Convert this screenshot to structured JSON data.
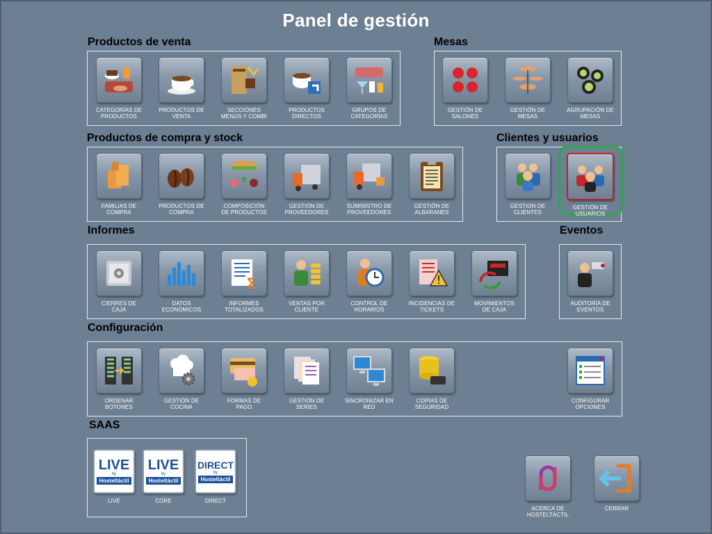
{
  "page_title": "Panel de gestión",
  "sections": {
    "productos_venta": "Productos de venta",
    "mesas": "Mesas",
    "compra_stock": "Productos de compra y stock",
    "clientes": "Clientes y usuarios",
    "informes": "Informes",
    "eventos": "Eventos",
    "configuracion": "Configuración",
    "saas": "SAAS"
  },
  "buttons": {
    "categorias_productos": [
      "CATEGORÍAS DE",
      "PRODUCTOS"
    ],
    "productos_venta": [
      "PRODUCTOS DE",
      "VENTA"
    ],
    "secciones_menus": [
      "SECCIONES",
      "MENÚS Y COMBI"
    ],
    "productos_directos": [
      "PRODUCTOS",
      "DIRECTOS"
    ],
    "grupos_categorias": [
      "GRUPOS DE",
      "CATEGORÍAS"
    ],
    "gestion_salones": [
      "GESTIÓN DE",
      "SALONES"
    ],
    "gestion_mesas": [
      "GESTIÓN DE",
      "MESAS"
    ],
    "agrupacion_mesas": [
      "AGRUPACIÓN DE",
      "MESAS"
    ],
    "familias_compra": [
      "FAMILIAS DE",
      "COMPRA"
    ],
    "productos_compra": [
      "PRODUCTOS DE",
      "COMPRA"
    ],
    "composicion_productos": [
      "COMPOSICIÓN",
      "DE PRODUCTOS"
    ],
    "gestion_proveedores": [
      "GESTIÓN DE",
      "PROVEEDORES"
    ],
    "suministro_proveedores": [
      "SUMINISTRO DE",
      "PROVEEDORES"
    ],
    "gestion_albaranes": [
      "GESTIÓN DE",
      "ALBARANES"
    ],
    "gestion_clientes": [
      "GESTION DE",
      "CLIENTES"
    ],
    "gestion_usuarios": [
      "GESTIÓN DE",
      "USUARIOS"
    ],
    "cierres_caja": [
      "CIERRES DE",
      "CAJA"
    ],
    "datos_economicos": [
      "DATOS",
      "ECONÓMICOS"
    ],
    "informes_totalizados": [
      "INFORMES",
      "TOTALIZADOS"
    ],
    "ventas_cliente": [
      "VENTAS POR",
      "CLIENTE"
    ],
    "control_horarios": [
      "CONTROL DE",
      "HORARIOS"
    ],
    "incidencias_tickets": [
      "INCIDENCIAS DE",
      "TICKETS"
    ],
    "movimientos_caja": [
      "MOVIMIENTOS",
      "DE CAJA"
    ],
    "auditoria_eventos": [
      "AUDITORÍA DE",
      "EVENTOS"
    ],
    "ordenar_botones": [
      "ORDENAR",
      "BOTONES"
    ],
    "gestion_cocina": [
      "GESTIÓN DE",
      "COCINA"
    ],
    "formas_pago": [
      "FORMAS DE",
      "PAGO"
    ],
    "gestion_series": [
      "GESTIÓN DE",
      "SERIES"
    ],
    "sincronizar_red": [
      "SINCRONIZAR EN",
      "RED"
    ],
    "copias_seguridad": [
      "COPIAS DE",
      "SEGURIDAD"
    ],
    "configurar_opciones": [
      "CONFIGURAR",
      "OPCIONES"
    ],
    "live": [
      "LIVE"
    ],
    "core": [
      "CORE"
    ],
    "direct": [
      "DIRECT"
    ],
    "acerca": [
      "ACERCA DE",
      "HOSTELTÁCTIL"
    ],
    "cerrar": [
      "CERRAR"
    ]
  },
  "saas_tiles": {
    "live": {
      "big": "LIVE",
      "by": "by",
      "sub": "Hosteltáctil"
    },
    "core": {
      "big": "LIVE",
      "by": "by",
      "sub": "Hosteltáctil"
    },
    "direct": {
      "big": "DIRECT",
      "by": "by",
      "sub": "Hosteltáctil"
    }
  },
  "colors": {
    "background": "#6d7f93",
    "selection_outline": "#2aa84a",
    "selected_border": "#c02020"
  }
}
